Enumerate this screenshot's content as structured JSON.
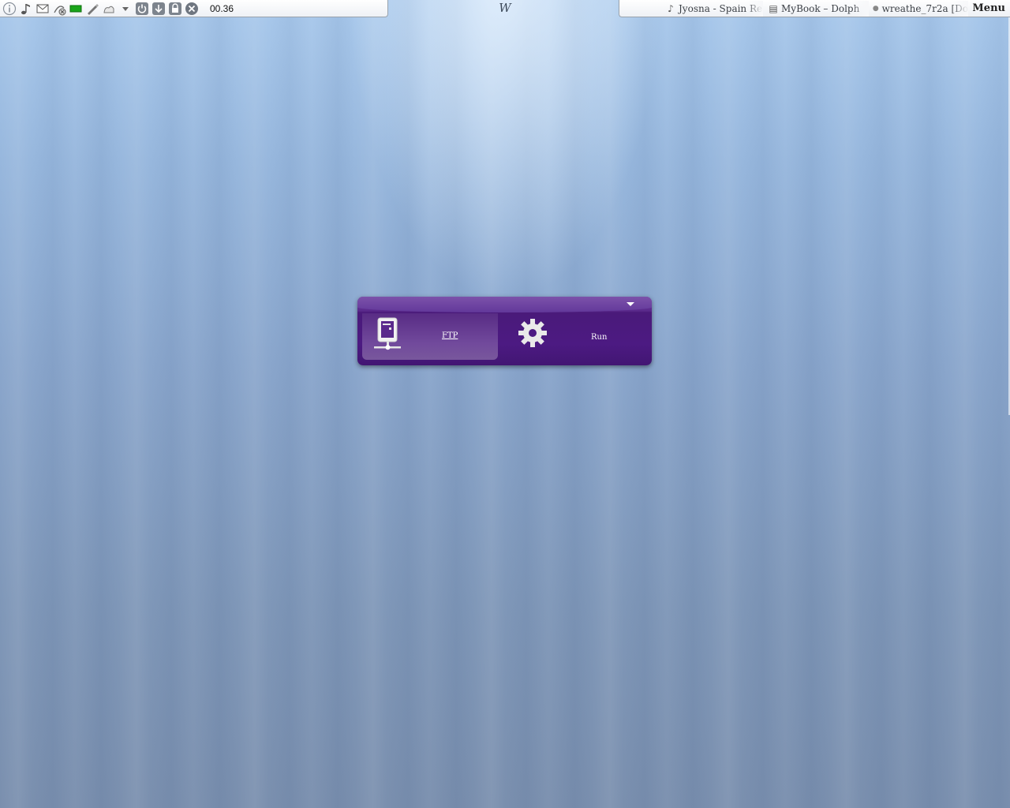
{
  "top_panel": {
    "tray_icons": [
      {
        "name": "info-icon",
        "glyph": "ⓘ"
      },
      {
        "name": "music-icon",
        "glyph": "♪"
      },
      {
        "name": "mail-icon",
        "glyph": "✉"
      },
      {
        "name": "network-disconnected-icon",
        "glyph": "⊗"
      },
      {
        "name": "battery-icon",
        "glyph": ""
      },
      {
        "name": "pen-icon",
        "glyph": "✎"
      },
      {
        "name": "clipboard-icon",
        "glyph": "✋"
      },
      {
        "name": "expand-tray-icon",
        "glyph": "▾"
      },
      {
        "name": "shutdown-icon",
        "glyph": "⏻"
      },
      {
        "name": "download-icon",
        "glyph": "⤓"
      },
      {
        "name": "lock-icon",
        "glyph": "⌂"
      },
      {
        "name": "close-icon",
        "glyph": "✕"
      }
    ],
    "clock": "00.36",
    "center_logo": "W",
    "tasks": [
      {
        "icon": "music-icon",
        "glyph": "♪",
        "label": "Jyosna - Spain Re"
      },
      {
        "icon": "file-manager-icon",
        "glyph": "▤",
        "label": "MyBook – Dolph"
      },
      {
        "icon": "document-icon",
        "glyph": "●",
        "label": "wreathe_7r2a [Do"
      }
    ],
    "menu_label": "Menu"
  },
  "launcher": {
    "items": [
      {
        "label": "FTP",
        "icon": "ftp-server-icon"
      },
      {
        "label": "Run",
        "icon": "gear-icon"
      }
    ]
  },
  "colors": {
    "launcher_purple": "#4c1a82",
    "desktop_blue": "#8aa6cc"
  }
}
